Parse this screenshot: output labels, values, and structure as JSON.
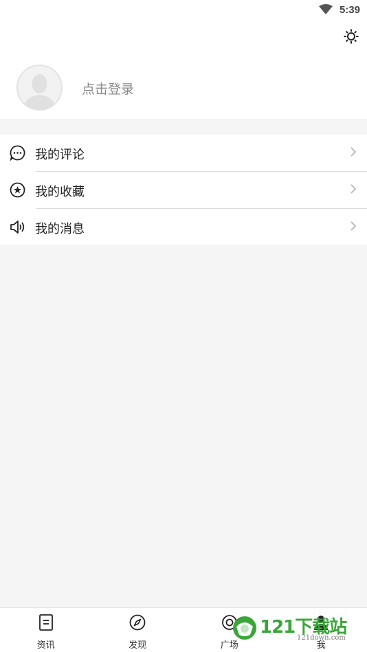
{
  "status_bar": {
    "time": "5:39",
    "wifi_icon": "wifi-icon"
  },
  "header": {
    "settings_icon": "gear-icon",
    "avatar_icon": "user-avatar-icon",
    "login_text": "点击登录"
  },
  "menu": {
    "items": [
      {
        "label": "我的评论",
        "icon": "comment-icon"
      },
      {
        "label": "我的收藏",
        "icon": "star-circle-icon"
      },
      {
        "label": "我的消息",
        "icon": "speaker-icon"
      }
    ]
  },
  "tab_bar": {
    "tabs": [
      {
        "label": "资讯",
        "icon": "news-icon"
      },
      {
        "label": "发现",
        "icon": "compass-icon"
      },
      {
        "label": "广场",
        "icon": "square-icon"
      },
      {
        "label": "我",
        "icon": "me-icon"
      }
    ]
  },
  "watermark": {
    "text": "121下载站",
    "subtext": "121down.com"
  },
  "colors": {
    "background": "#f5f5f5",
    "surface": "#ffffff",
    "text": "#222222",
    "muted": "#8a8a8a",
    "watermark_green": "#3aa63a"
  }
}
